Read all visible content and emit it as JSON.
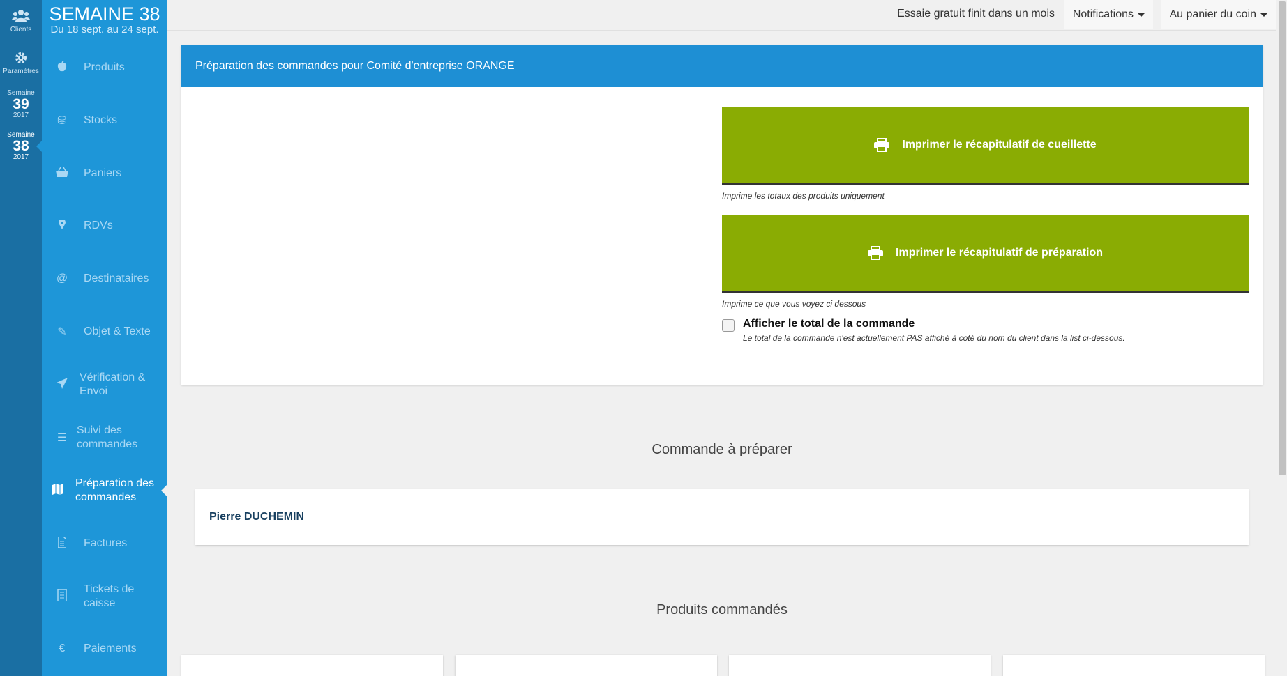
{
  "rail": {
    "clients_label": "Clients",
    "parametres_label": "Paramètres",
    "weeks": [
      {
        "small": "Semaine",
        "number": "39",
        "year": "2017"
      },
      {
        "small": "Semaine",
        "number": "38",
        "year": "2017"
      }
    ]
  },
  "sidebar": {
    "week_title": "SEMAINE 38",
    "week_range": "Du 18 sept. au 24 sept.",
    "items": [
      {
        "label": "Produits",
        "icon": "apple-icon",
        "glyph": ""
      },
      {
        "label": "Stocks",
        "icon": "stock-icon",
        "glyph": "⛁"
      },
      {
        "label": "Paniers",
        "icon": "basket-icon",
        "glyph": ""
      },
      {
        "label": "RDVs",
        "icon": "map-marker-icon",
        "glyph": ""
      },
      {
        "label": "Destinataires",
        "icon": "at-icon",
        "glyph": "@"
      },
      {
        "label": "Objet & Texte",
        "icon": "pencil-icon",
        "glyph": "✎"
      },
      {
        "label": "Vérification & Envoi",
        "icon": "paper-plane-icon",
        "glyph": ""
      },
      {
        "label": "Suivi des commandes",
        "icon": "list-icon",
        "glyph": "☰"
      },
      {
        "label": "Préparation des commandes",
        "icon": "map-icon",
        "glyph": ""
      },
      {
        "label": "Factures",
        "icon": "file-icon",
        "glyph": ""
      },
      {
        "label": "Tickets de caisse",
        "icon": "receipt-icon",
        "glyph": ""
      },
      {
        "label": "Paiements",
        "icon": "euro-icon",
        "glyph": "€"
      }
    ]
  },
  "topbar": {
    "trial_text": "Essaie gratuit finit dans un mois",
    "notifications_label": "Notifications",
    "account_label": "Au panier du coin"
  },
  "panel": {
    "title": "Préparation des commandes pour Comité d'entreprise ORANGE",
    "btn_cueillette": "Imprimer le récapitulatif de cueillette",
    "hint_cueillette": "Imprime les totaux des produits uniquement",
    "btn_preparation": "Imprimer le récapitulatif de préparation",
    "hint_preparation": "Imprime ce que vous voyez ci dessous",
    "checkbox_label": "Afficher le total de la commande",
    "checkbox_note": "Le total de la commande n'est actuellement PAS affiché à coté du nom du client dans la list ci-dessous.",
    "checkbox_checked": false
  },
  "orders": {
    "title": "Commande à préparer",
    "clients": [
      "Pierre DUCHEMIN"
    ]
  },
  "products": {
    "title": "Produits commandés"
  },
  "colors": {
    "sidebar": "#1e96d8",
    "rail": "#1a6fa3",
    "panel_header": "#1e8fd4",
    "print_button": "#8aac03",
    "client_name": "#173f5f"
  }
}
